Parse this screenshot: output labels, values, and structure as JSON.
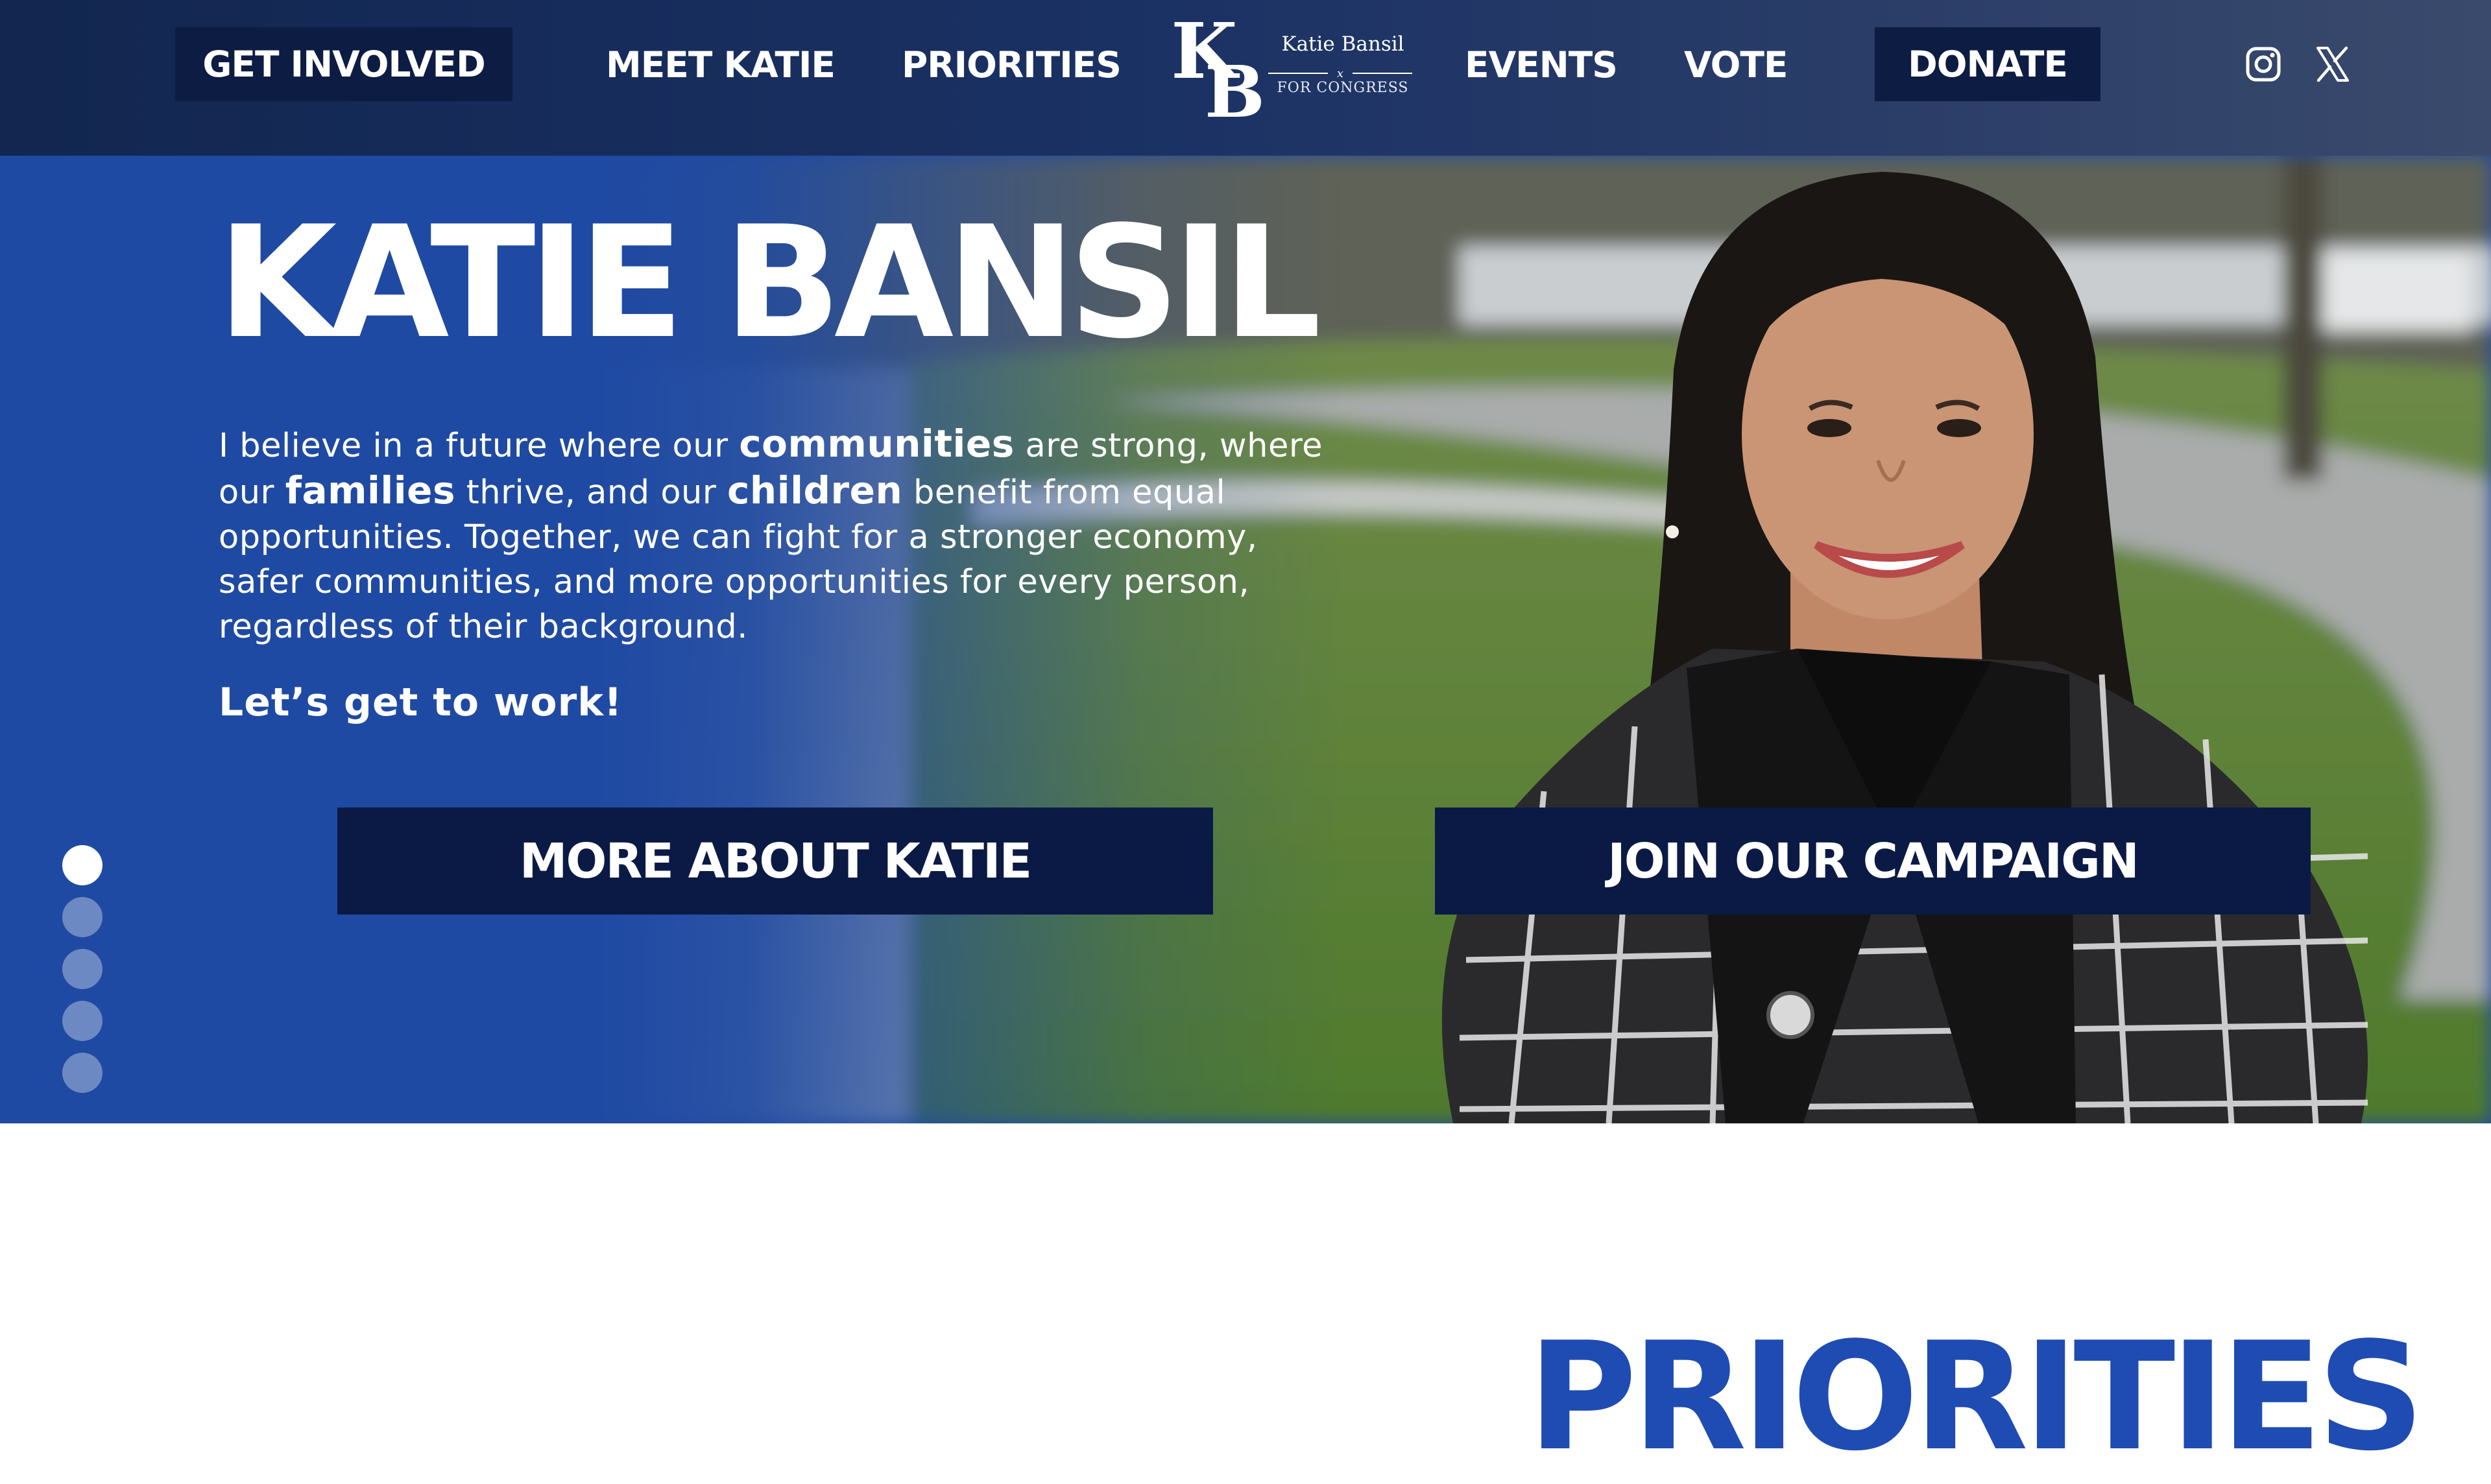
{
  "nav": {
    "get_involved": "GET INVOLVED",
    "meet_katie": "MEET KATIE",
    "priorities": "PRIORITIES",
    "events": "EVENTS",
    "vote": "VOTE",
    "donate": "DONATE",
    "logo": {
      "monogram": "KB",
      "name": "Katie Bansil",
      "divider": "x",
      "sub": "FOR CONGRESS"
    },
    "social": [
      "instagram-icon",
      "x-icon"
    ]
  },
  "hero": {
    "title": "KATIE BANSIL",
    "body": {
      "p1": "I believe in a future where our ",
      "b1": "communities",
      "p2": " are strong, where our ",
      "b2": "families",
      "p3": " thrive, and our ",
      "b3": "children",
      "p4": " benefit from equal opportunities. Together, we can fight for a stronger economy, safer communities, and more opportunities for every person, regardless of their background."
    },
    "cta_text": "Let’s get to work!",
    "button_more": "MORE ABOUT KATIE",
    "button_join": "JOIN OUR CAMPAIGN",
    "slides": {
      "count": 5,
      "active": 1
    }
  },
  "priorities": {
    "heading": "PRIORITIES"
  },
  "colors": {
    "nav_bg": "#12264f",
    "button_navy": "#0b1a45",
    "hero_blue": "#1f4aa3",
    "heading_blue": "#1f4cb3"
  }
}
